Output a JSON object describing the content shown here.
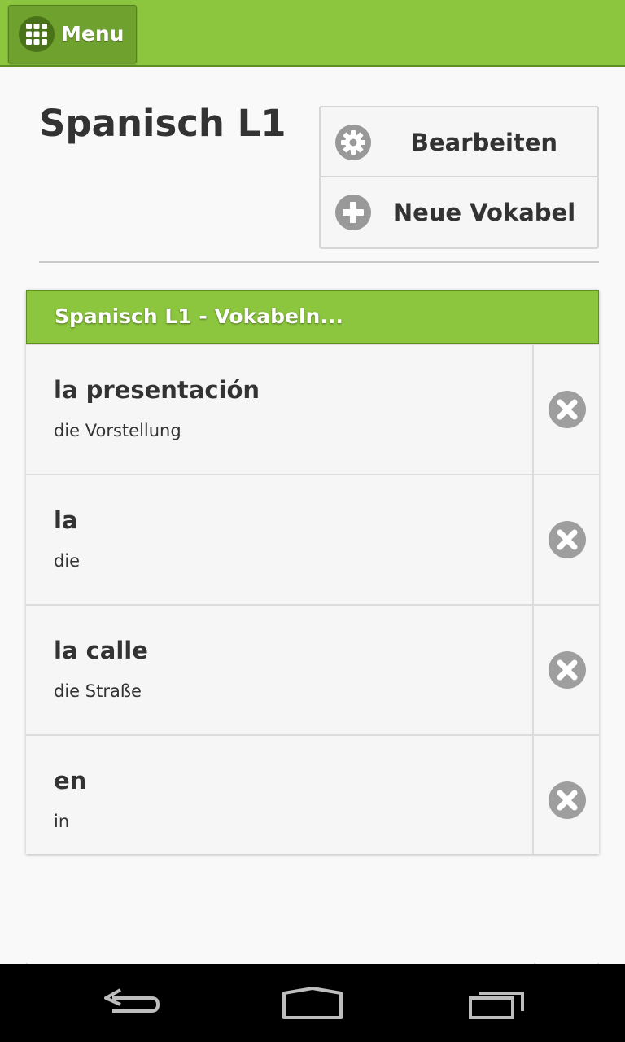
{
  "header": {
    "menu_label": "Menu",
    "menu_icon": "grid-icon",
    "accent_color": "#8cc63e"
  },
  "page": {
    "title": "Spanisch L1"
  },
  "actions": {
    "edit_label": "Bearbeiten",
    "edit_icon": "gear-icon",
    "new_label": "Neue Vokabel",
    "new_icon": "plus-icon"
  },
  "list": {
    "header_title": "Spanisch L1 - Vokabeln...",
    "items": [
      {
        "word": "la presentación",
        "translation": "die Vorstellung"
      },
      {
        "word": "la",
        "translation": "die"
      },
      {
        "word": "la calle",
        "translation": "die Straße"
      },
      {
        "word": "en",
        "translation": "in"
      }
    ],
    "delete_icon": "close-circle-icon"
  },
  "navbar": {
    "back_icon": "back-icon",
    "home_icon": "home-icon",
    "recents_icon": "recents-icon"
  }
}
